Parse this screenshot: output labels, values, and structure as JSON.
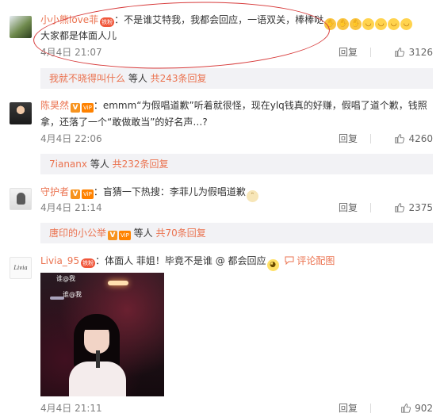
{
  "comments": [
    {
      "username": "小小熊love菲",
      "lv_badge": "铁粉",
      "text": "：不是谁艾特我，我都会回应，一语双关，棒棒哒",
      "text_line2": "大家都是体面人儿",
      "emojis": [
        "clap",
        "clap",
        "clap",
        "laugh",
        "laugh",
        "laugh",
        "laugh"
      ],
      "time": "4月4日 21:07",
      "reply_label": "回复",
      "likes": "3126",
      "sub": {
        "user": "我就不晓得叫什么",
        "mid": " 等人 ",
        "count": "共243条回复"
      }
    },
    {
      "username": "陈昊然",
      "text": "：emmm“为假唱道歉”听着就很怪，现在ylq钱真的好赚，假唱了道个歉，钱照",
      "text_line2": "拿，还落了一个“敢做敢当”的好名声…?",
      "time": "4月4日 22:06",
      "reply_label": "回复",
      "likes": "4260",
      "sub": {
        "user": "7iananx",
        "mid": " 等人 ",
        "count": "共232条回复"
      }
    },
    {
      "username": "守护者",
      "text": "：盲猜一下热搜：李菲儿为假唱道歉",
      "time": "4月4日 21:14",
      "reply_label": "回复",
      "likes": "2375",
      "sub": {
        "user": "唐印的小公举",
        "mid": " 等人 ",
        "count": "共70条回复"
      }
    },
    {
      "username": "Livia_95",
      "lv_badge": "铁粉",
      "avatar_text": "Livia",
      "text": "：体面人 菲姐！毕竟不是谁 @ 都会回应",
      "comment_pic_label": "评论配图",
      "photo_captions": [
        "谁@我",
        "谁@我"
      ],
      "time": "4月4日 21:11",
      "reply_label": "回复",
      "likes": "902"
    }
  ],
  "colors": {
    "username": "#eb7350",
    "annotation_circle": "#d73a3a",
    "sub_bar_bg": "#f2f2f5"
  },
  "icons": [
    "vip-v-icon",
    "level-badge-icon",
    "thumb-up-icon",
    "comment-picture-icon"
  ]
}
